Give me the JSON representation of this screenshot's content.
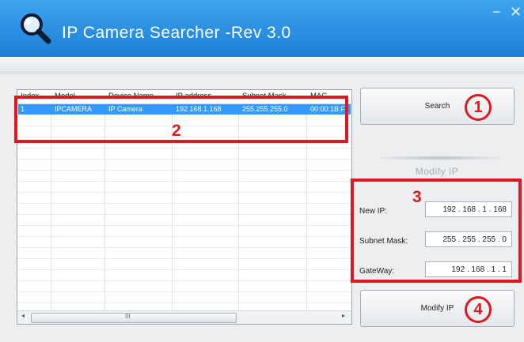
{
  "app": {
    "title": "IP Camera Searcher -Rev 3.0",
    "minimize_glyph": "−",
    "close_glyph": "✕",
    "logo_icon": "magnifier-icon"
  },
  "table": {
    "headers": [
      "Index",
      "Model",
      "Device Name",
      "IP address",
      "Subnet Mask",
      "MAC"
    ],
    "rows": [
      [
        "1",
        "IPCAMERA",
        "IP Camera",
        "192.168.1.168",
        "255.255.255.0",
        "00:00:1B:F"
      ]
    ],
    "scroll_left": "◂",
    "scroll_right": "▸",
    "scroll_grip": "III"
  },
  "buttons": {
    "search": "Search",
    "modify": "Modify IP"
  },
  "modify_panel": {
    "title": "Modify IP",
    "new_ip_label": "New IP:",
    "new_ip_value": "192 . 168 . 1 . 168",
    "subnet_label": "Subnet Mask:",
    "subnet_value": "255 . 255 . 255 . 0",
    "gateway_label": "GateWay:",
    "gateway_value": "192 . 168 . 1 . 1"
  },
  "annotations": {
    "one": "1",
    "two": "2",
    "three": "3",
    "four": "4",
    "color": "#e0171f"
  }
}
